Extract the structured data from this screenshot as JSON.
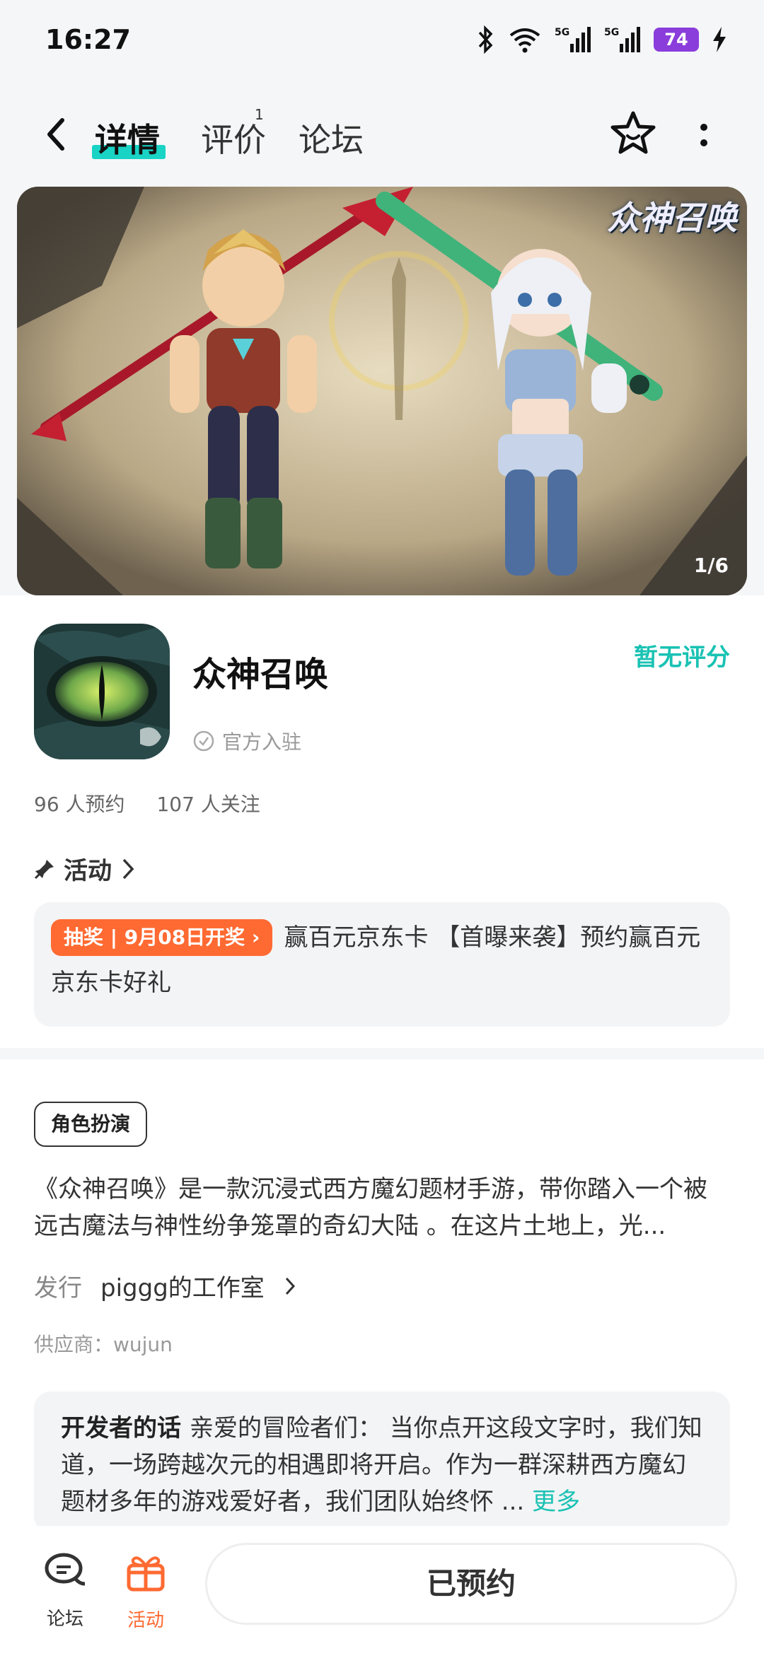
{
  "status_bar": {
    "time": "16:27",
    "battery": "74",
    "network1": "5G",
    "network2": "5G"
  },
  "nav": {
    "tabs": [
      {
        "label": "详情",
        "active": true
      },
      {
        "label": "评价",
        "badge": "1"
      },
      {
        "label": "论坛"
      }
    ]
  },
  "banner": {
    "counter": "1/6",
    "logo_text": "众神召唤"
  },
  "app": {
    "name": "众神召唤",
    "rating": "暂无评分",
    "verified": "官方入驻",
    "reservations": "96 人预约",
    "followers": "107 人关注"
  },
  "activity": {
    "heading": "活动",
    "tag": "抽奖 | 9月08日开奖",
    "text": "赢百元京东卡 【首曝来袭】预约赢百元京东卡好礼"
  },
  "details": {
    "genre": "角色扮演",
    "description": "《众神召唤》是一款沉浸式西方魔幻题材手游，带你踏入一个被远古魔法与神性纷争笼罩的奇幻大陆 。在这片土地上，光...",
    "publisher_label": "发行",
    "publisher": "piggg的工作室",
    "supplier": "供应商：wujun",
    "dev_title": "开发者的话",
    "dev_text": "亲爱的冒险者们： 当你点开这段文字时，我们知道，一场跨越次元的相遇即将开启。作为一群深耕西方魔幻题材多年的游戏爱好者，我们团队始终怀 ...",
    "more": "更多"
  },
  "bottom": {
    "forum_label": "论坛",
    "activity_label": "活动",
    "reserve_label": "已预约"
  },
  "colors": {
    "accent": "#19c2b3",
    "orange": "#ff6a32",
    "battery": "#8a3ddb"
  }
}
